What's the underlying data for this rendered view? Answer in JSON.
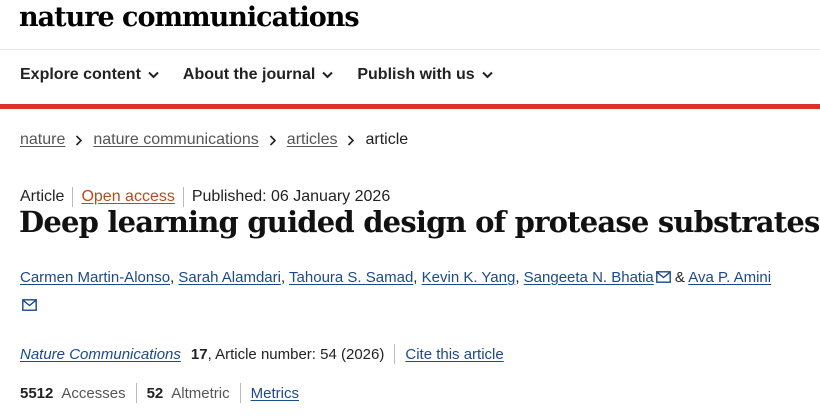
{
  "header": {
    "brand": "nature communications",
    "nav": [
      {
        "label": "Explore content"
      },
      {
        "label": "About the journal"
      },
      {
        "label": "Publish with us"
      }
    ],
    "accent_color": "#d8322b"
  },
  "breadcrumb": {
    "items": [
      "nature",
      "nature communications",
      "articles"
    ],
    "current": "article"
  },
  "article": {
    "type": "Article",
    "open_access": "Open access",
    "published": "Published: 06 January 2026",
    "title": "Deep learning guided design of protease substrates",
    "authors": [
      "Carmen Martin-Alonso",
      "Sarah Alamdari",
      "Tahoura S. Samad",
      "Kevin K. Yang",
      "Sangeeta N. Bhatia",
      "Ava P. Amini"
    ],
    "journal": "Nature Communications",
    "volume": "17",
    "article_number": ", Article number: 54 (2026)",
    "cite_label": "Cite this article",
    "accesses_count": "5512",
    "accesses_label": "Accesses",
    "altmetric_count": "52",
    "altmetric_label": "Altmetric",
    "metrics_label": "Metrics"
  }
}
